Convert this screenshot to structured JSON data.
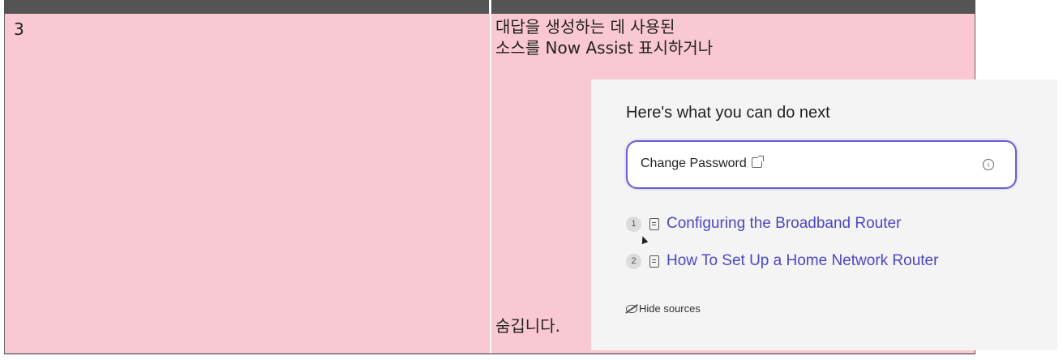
{
  "table": {
    "row_number": "3",
    "description_lines": [
      "대답을 생성하는 데 사용된",
      "소스를 Now Assist 표시하거나"
    ],
    "description_end": "숨깁니다."
  },
  "screenshot": {
    "title": "Here's what you can do next",
    "action_label": "Change Password",
    "sources": [
      {
        "num": "1",
        "label": "Configuring the Broadband Router"
      },
      {
        "num": "2",
        "label": "How To Set Up a Home Network Router"
      }
    ],
    "hide_sources_label": "Hide sources",
    "accent_color": "#6a5fcf",
    "link_color": "#4a47c4",
    "row_bg": "#f9c8d2",
    "header_bg": "#545454"
  }
}
